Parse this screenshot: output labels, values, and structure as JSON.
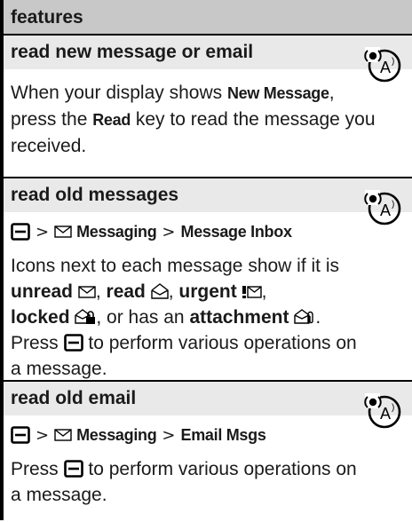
{
  "header": {
    "title": "features"
  },
  "sections": [
    {
      "title": "read new message or email",
      "body_parts": [
        "When your display shows ",
        "New Message",
        ",",
        "press the ",
        "Read",
        " key to read the message you received."
      ]
    },
    {
      "title": "read old messages",
      "path": [
        "Messaging",
        "Message Inbox"
      ],
      "body": {
        "p1": "Icons next to each message show if it is",
        "unread": "unread",
        "read": "read",
        "urgent": "urgent",
        "locked": "locked",
        "or_has_an": ", or has an",
        "attachment": "attachment",
        "press": "Press",
        "perform": "to perform various operations on",
        "a_message": "a message."
      }
    },
    {
      "title": "read old email",
      "path": [
        "Messaging",
        "Email Msgs"
      ],
      "body": {
        "press": "Press",
        "perform": "to perform various operations on",
        "a_message": "a message."
      }
    }
  ],
  "separator": ">",
  "icons": {
    "network": "network-service-icon",
    "menu_key": "menu-key-icon",
    "envelope": "envelope-icon",
    "read_envelope": "opened-envelope-icon",
    "urgent": "urgent-envelope-icon",
    "locked": "locked-envelope-icon",
    "attachment": "attachment-envelope-icon"
  }
}
